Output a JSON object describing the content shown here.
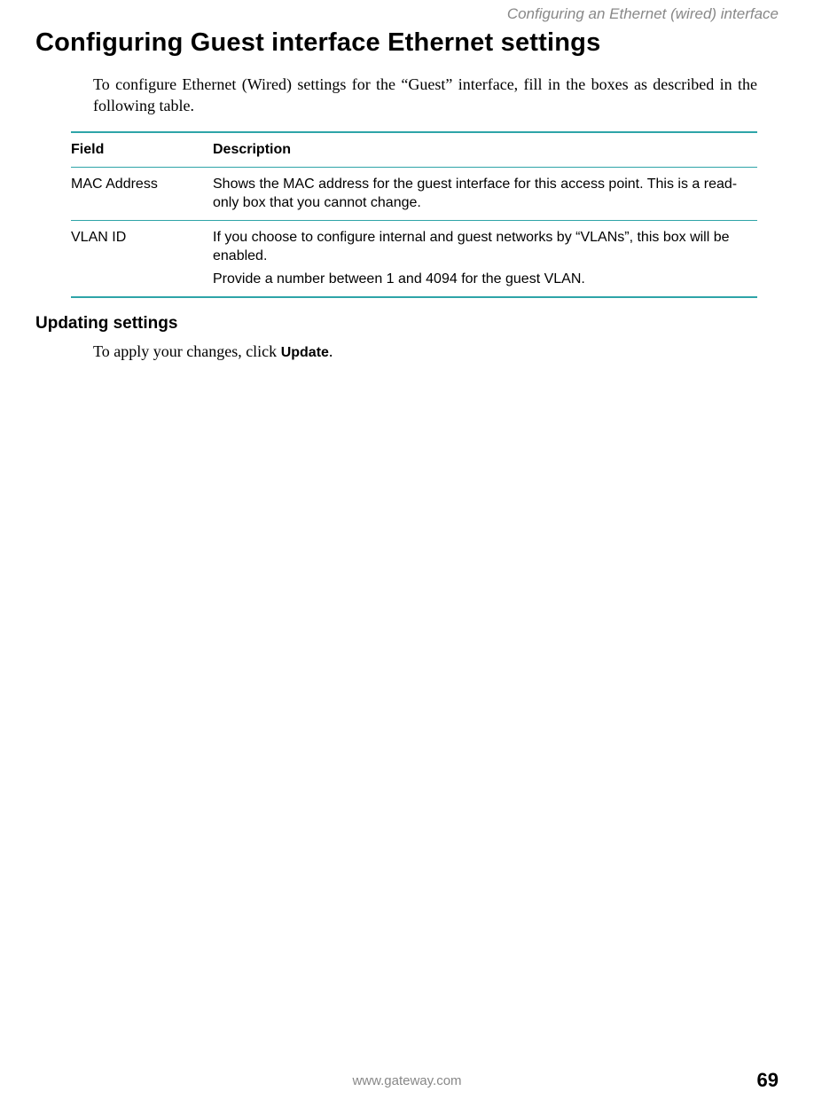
{
  "running_header": "Configuring an Ethernet (wired) interface",
  "heading": "Configuring Guest interface Ethernet settings",
  "intro": "To configure Ethernet (Wired) settings for the “Guest” interface, fill in the boxes as described in the following table.",
  "table": {
    "headers": {
      "field": "Field",
      "description": "Description"
    },
    "rows": [
      {
        "field": "MAC Address",
        "description": "Shows the MAC address for the guest interface for this access point. This is a read-only box that you cannot change."
      },
      {
        "field": "VLAN ID",
        "description_p1": "If you choose to configure internal and guest networks by “VLANs”, this box will be enabled.",
        "description_p2": "Provide a number between 1 and 4094 for the guest VLAN."
      }
    ]
  },
  "subheading": "Updating settings",
  "update_text_prefix": "To apply your changes, click ",
  "update_word": "Update",
  "update_text_suffix": ".",
  "footer": {
    "url": "www.gateway.com",
    "page_number": "69"
  }
}
